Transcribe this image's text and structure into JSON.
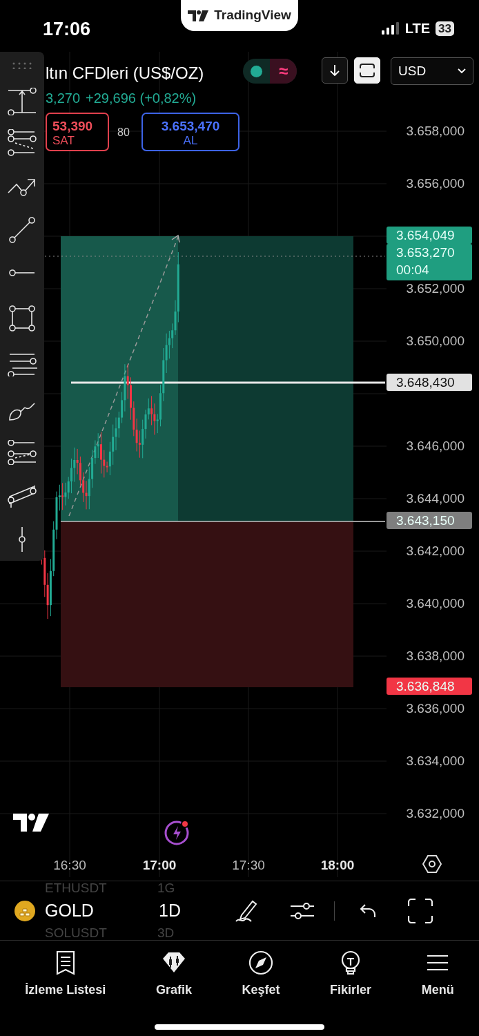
{
  "status_bar": {
    "time": "17:06",
    "network": "LTE",
    "battery": "33"
  },
  "banner": {
    "title": "TradingView"
  },
  "symbol": {
    "title": "ltın CFDleri (US$/OZ)",
    "session_open": true,
    "session_mark": "≈",
    "last": "3,270",
    "change": "+29,696 (+0,82%)",
    "currency": "USD"
  },
  "order": {
    "sell_price": "53,390",
    "sell_label": "SAT",
    "spread": "80",
    "buy_price": "3.653,470",
    "buy_label": "AL"
  },
  "price_axis": [
    "3.658,000",
    "3.656,000",
    "3.652,000",
    "3.650,000",
    "3.646,000",
    "3.644,000",
    "3.642,000",
    "3.640,000",
    "3.638,000",
    "3.636,000",
    "3.634,000",
    "3.632,000"
  ],
  "price_tags": [
    {
      "text": "3.654,049",
      "color": "#1f9e80"
    },
    {
      "text": "3.653,270",
      "countdown": "00:04",
      "color": "#1f9e80"
    },
    {
      "text": "3.648,430",
      "color": "#e2e2e2"
    },
    {
      "text": "3.643,150",
      "color": "#7e7e7e"
    },
    {
      "text": "3.636,848",
      "color": "#f23645"
    }
  ],
  "time_axis": [
    {
      "label": "16:30",
      "major": false
    },
    {
      "label": "17:00",
      "major": true
    },
    {
      "label": "17:30",
      "major": false
    },
    {
      "label": "18:00",
      "major": true
    }
  ],
  "toolbar": {
    "symbol": "GOLD",
    "interval": "1D",
    "ghost_above": [
      "ETHUSDT",
      "1G"
    ],
    "ghost_below": [
      "SOLUSDT",
      "3D"
    ]
  },
  "nav": [
    {
      "label": "İzleme Listesi"
    },
    {
      "label": "Grafik"
    },
    {
      "label": "Keşfet"
    },
    {
      "label": "Fikirler"
    },
    {
      "label": "Menü"
    }
  ]
}
